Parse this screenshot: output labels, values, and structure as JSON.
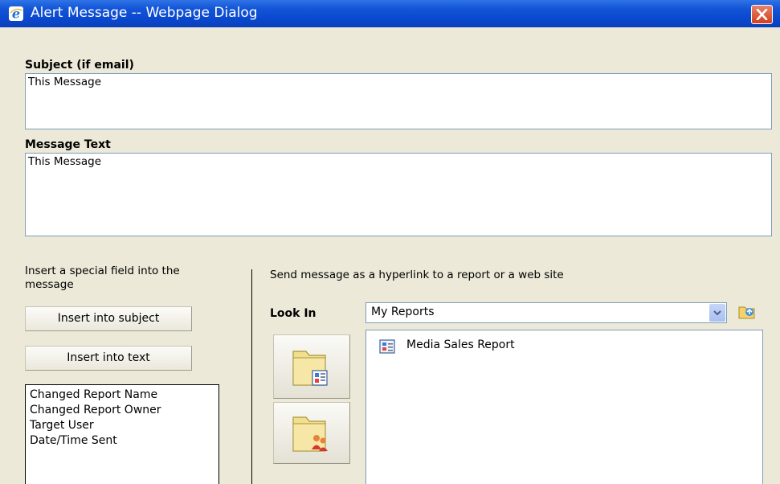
{
  "window": {
    "title": "Alert Message -- Webpage Dialog",
    "icon": "ie-icon",
    "close_icon": "close-icon"
  },
  "subject": {
    "label": "Subject (if email)",
    "value": "This Message"
  },
  "message": {
    "label": "Message Text",
    "value": "This Message"
  },
  "special_field": {
    "instruction": "Insert a special field into the message",
    "insert_subject_label": "Insert into subject",
    "insert_text_label": "Insert into text",
    "fields": [
      "Changed Report Name",
      "Changed Report Owner",
      "Target User",
      "Date/Time Sent"
    ]
  },
  "hyperlink": {
    "instruction": "Send message as a hyperlink to a report or a web site",
    "look_in_label": "Look In",
    "look_in_value": "My Reports",
    "items": [
      {
        "name": "Media Sales Report",
        "icon": "report-icon"
      }
    ]
  },
  "colors": {
    "titlebar": "#0a48cf",
    "background": "#ece9d8",
    "close": "#d1401e"
  }
}
